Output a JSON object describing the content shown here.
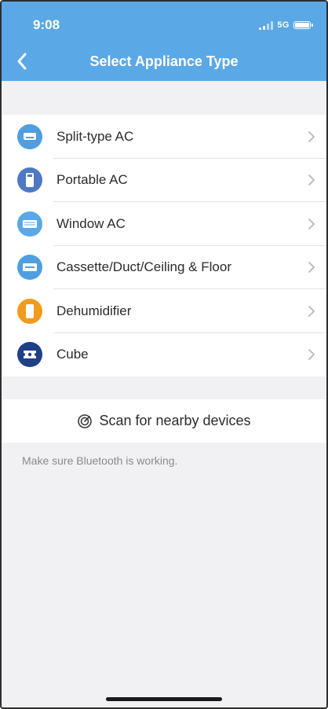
{
  "status_bar": {
    "time": "9:08",
    "network": "5G"
  },
  "nav": {
    "title": "Select Appliance Type"
  },
  "appliances": [
    {
      "label": "Split-type AC",
      "icon": "split-ac-icon",
      "color": "#4f9fe0"
    },
    {
      "label": "Portable AC",
      "icon": "portable-ac-icon",
      "color": "#4e78c4"
    },
    {
      "label": "Window AC",
      "icon": "window-ac-icon",
      "color": "#5aa8e6"
    },
    {
      "label": "Cassette/Duct/Ceiling & Floor",
      "icon": "cassette-ac-icon",
      "color": "#4f9fe0"
    },
    {
      "label": "Dehumidifier",
      "icon": "dehumidifier-icon",
      "color": "#f29a1f"
    },
    {
      "label": "Cube",
      "icon": "cube-icon",
      "color": "#1f3f86"
    }
  ],
  "scan": {
    "label": "Scan for nearby devices"
  },
  "hint": "Make sure Bluetooth is working.",
  "colors": {
    "header": "#5aa8e6",
    "background": "#f1f1f3"
  }
}
